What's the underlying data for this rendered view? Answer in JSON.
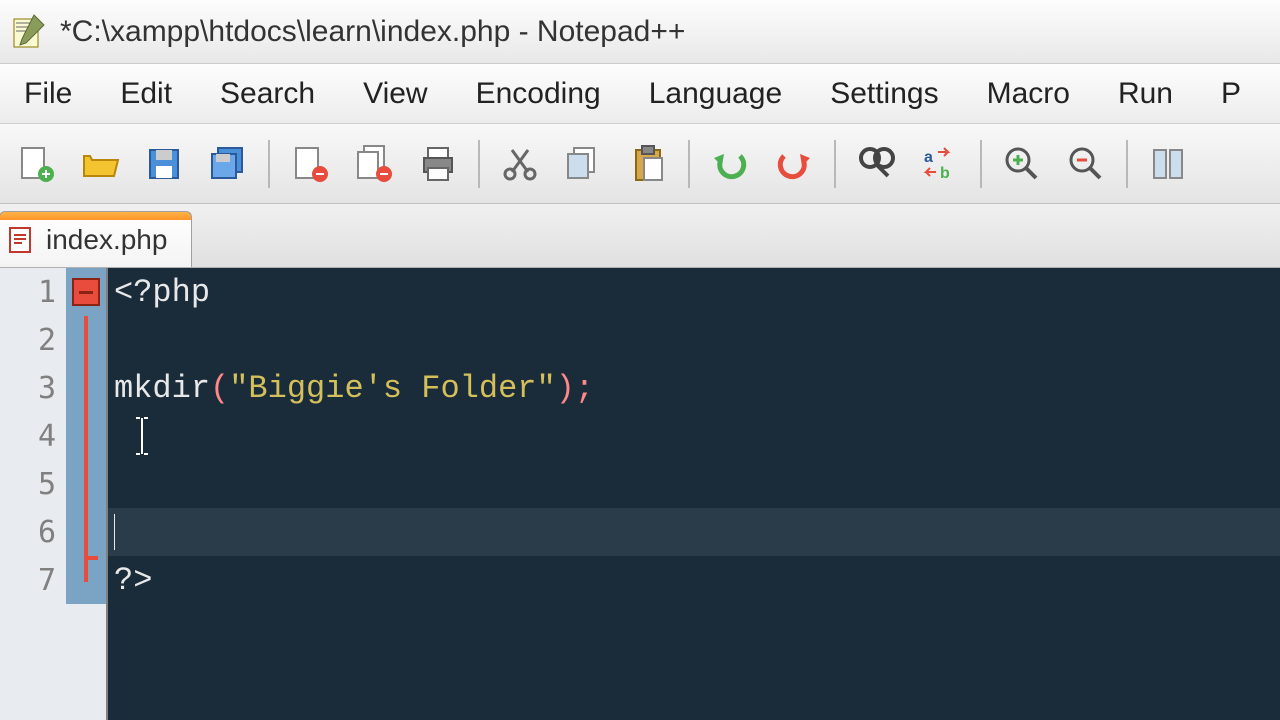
{
  "window": {
    "title": "*C:\\xampp\\htdocs\\learn\\index.php - Notepad++"
  },
  "menu": {
    "items": [
      "File",
      "Edit",
      "Search",
      "View",
      "Encoding",
      "Language",
      "Settings",
      "Macro",
      "Run",
      "P"
    ]
  },
  "toolbar": {
    "icons": [
      "new-file-icon",
      "open-file-icon",
      "save-icon",
      "save-all-icon",
      "close-icon",
      "close-all-icon",
      "print-icon",
      "cut-icon",
      "copy-icon",
      "paste-icon",
      "undo-icon",
      "redo-icon",
      "find-icon",
      "replace-icon",
      "zoom-in-icon",
      "zoom-out-icon",
      "sync-icon"
    ]
  },
  "tab": {
    "label": "index.php"
  },
  "editor": {
    "lines": {
      "1": {
        "open_tag": "<?php"
      },
      "3": {
        "fn": "mkdir",
        "open": "(",
        "str": "\"Biggie's Folder\"",
        "close": ")",
        "semi": ";"
      },
      "7": {
        "close_tag": "?>"
      }
    },
    "line_numbers": [
      "1",
      "2",
      "3",
      "4",
      "5",
      "6",
      "7"
    ],
    "current_line": 6
  }
}
